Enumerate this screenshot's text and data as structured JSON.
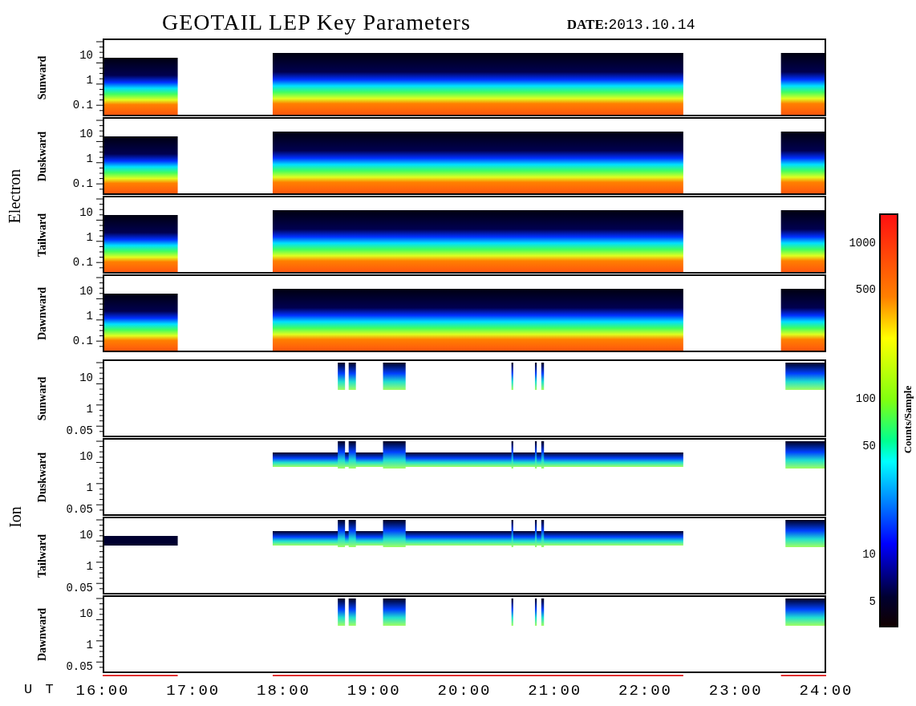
{
  "title": "GEOTAIL LEP Key Parameters",
  "date_label": "DATE:",
  "date": "2013.10.14",
  "groups": [
    {
      "name": "Electron",
      "kind": "electron",
      "panels": [
        {
          "label": "Sunward",
          "yticks": [
            "10",
            "1",
            "0.1"
          ]
        },
        {
          "label": "Duskward",
          "yticks": [
            "10",
            "1",
            "0.1"
          ]
        },
        {
          "label": "Tailward",
          "yticks": [
            "10",
            "1",
            "0.1"
          ]
        },
        {
          "label": "Dawnward",
          "yticks": [
            "10",
            "1",
            "0.1"
          ]
        }
      ]
    },
    {
      "name": "Ion",
      "kind": "ion",
      "panels": [
        {
          "label": "Sunward",
          "yticks": [
            "10",
            "1",
            "0.05"
          ]
        },
        {
          "label": "Duskward",
          "yticks": [
            "10",
            "1",
            "0.05"
          ]
        },
        {
          "label": "Tailward",
          "yticks": [
            "10",
            "1",
            "0.05"
          ]
        },
        {
          "label": "Dawnward",
          "yticks": [
            "10",
            "1",
            "0.05"
          ]
        }
      ]
    }
  ],
  "x_axis": {
    "label": "U T",
    "ticks": [
      "16:00",
      "17:00",
      "18:00",
      "19:00",
      "20:00",
      "21:00",
      "22:00",
      "23:00",
      "24:00"
    ]
  },
  "colorbar": {
    "label": "Counts/Sample",
    "ticks": [
      "1000",
      "500",
      "100",
      "50",
      "10",
      "5"
    ]
  }
}
